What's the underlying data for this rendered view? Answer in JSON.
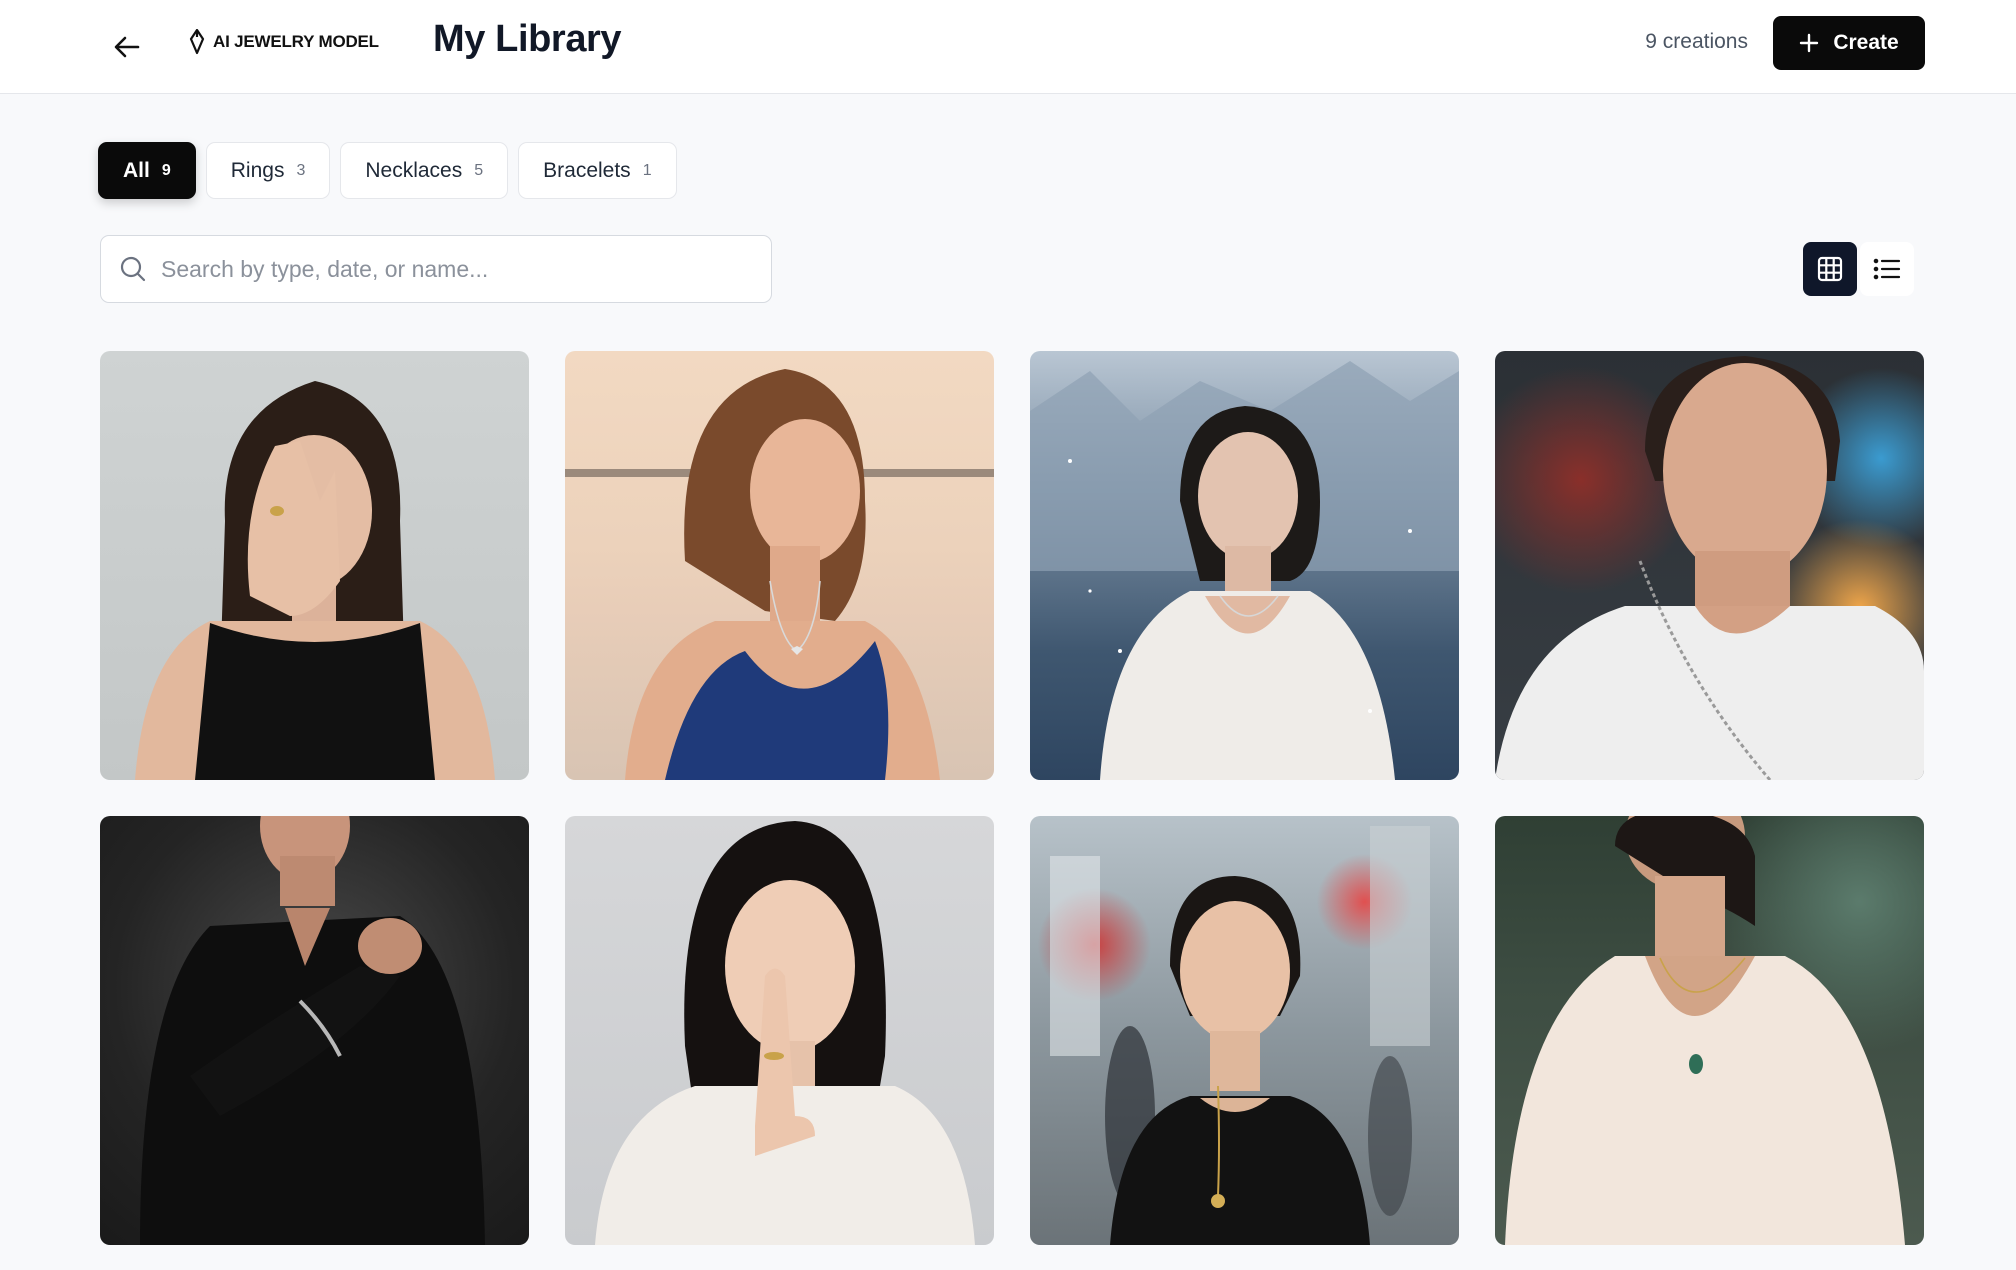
{
  "header": {
    "brand": "AI JEWELRY MODEL",
    "title": "My Library",
    "count_label": "9 creations",
    "create_label": "Create"
  },
  "filters": [
    {
      "label": "All",
      "count": "9",
      "active": true
    },
    {
      "label": "Rings",
      "count": "3",
      "active": false
    },
    {
      "label": "Necklaces",
      "count": "5",
      "active": false
    },
    {
      "label": "Bracelets",
      "count": "1",
      "active": false
    }
  ],
  "search": {
    "placeholder": "Search by type, date, or name...",
    "value": ""
  },
  "view": {
    "active": "grid",
    "icons": [
      "grid-icon",
      "list-icon"
    ]
  },
  "gallery": [
    {
      "category": "ring",
      "subject": "woman hand over face wearing gold ring"
    },
    {
      "category": "necklace",
      "subject": "woman in blue dress with heart pendant by the sea"
    },
    {
      "category": "necklace",
      "subject": "woman in white blouse with necklace in snowy mountains"
    },
    {
      "category": "necklace",
      "subject": "man in white t-shirt with chain necklace at night city"
    },
    {
      "category": "bracelet",
      "subject": "man in black shirt wearing silver bracelet"
    },
    {
      "category": "ring",
      "subject": "woman with finger on lips wearing gold ring"
    },
    {
      "category": "necklace",
      "subject": "woman in black top with gold coin pendant in city street"
    },
    {
      "category": "necklace",
      "subject": "woman in white blouse with green pendant necklace"
    }
  ],
  "colors": {
    "primary": "#0a0a0a",
    "background": "#f8f9fb",
    "border": "#e5e7eb",
    "muted_text": "#6b7280"
  }
}
